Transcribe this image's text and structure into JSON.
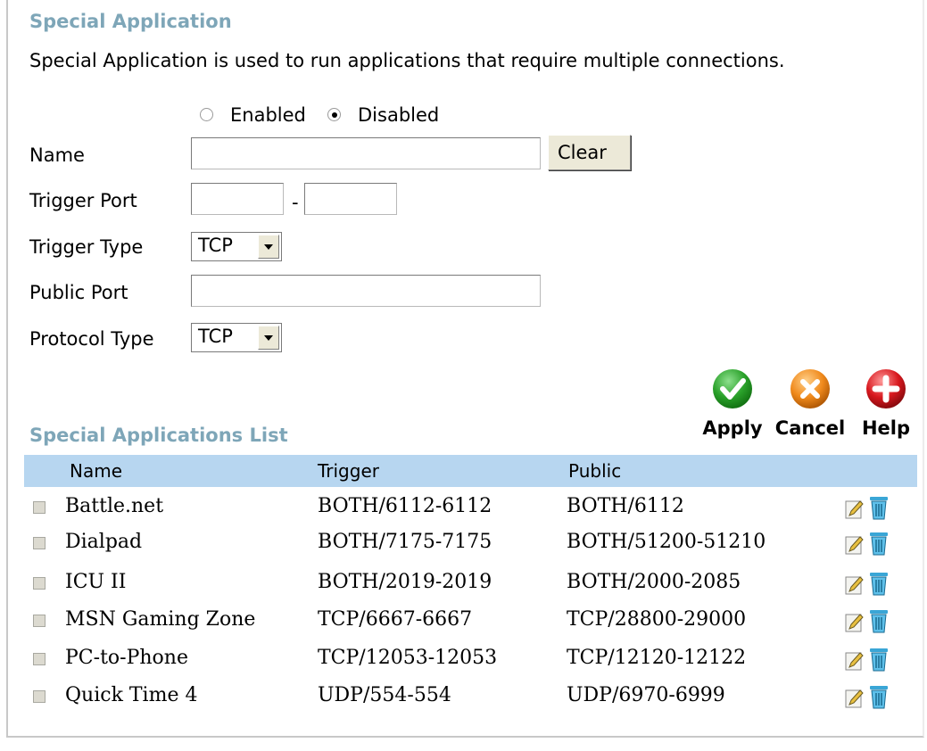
{
  "header": {
    "title": "Special Application",
    "description": "Special Application is used to run applications that require multiple connections."
  },
  "form": {
    "enabled_label": "Enabled",
    "disabled_label": "Disabled",
    "selected": "Disabled",
    "name_label": "Name",
    "name_value": "",
    "clear_label": "Clear",
    "trigger_port_label": "Trigger Port",
    "trigger_port_start": "",
    "trigger_port_sep": "-",
    "trigger_port_end": "",
    "trigger_type_label": "Trigger Type",
    "trigger_type_value": "TCP",
    "public_port_label": "Public Port",
    "public_port_value": "",
    "protocol_type_label": "Protocol Type",
    "protocol_type_value": "TCP"
  },
  "actions": {
    "apply_label": "Apply",
    "cancel_label": "Cancel",
    "help_label": "Help",
    "apply_color": "#2aa12a",
    "cancel_color": "#f08a1c",
    "help_color": "#d8181e"
  },
  "list": {
    "title": "Special Applications List",
    "columns": [
      "Name",
      "Trigger",
      "Public"
    ],
    "header_color": "#b7d6f0",
    "rows": [
      {
        "name": "Battle.net",
        "trigger": "BOTH/6112-6112",
        "public": "BOTH/6112"
      },
      {
        "name": "Dialpad",
        "trigger": "BOTH/7175-7175",
        "public": "BOTH/51200-51210"
      },
      {
        "name": "ICU II",
        "trigger": "BOTH/2019-2019",
        "public": "BOTH/2000-2085"
      },
      {
        "name": "MSN Gaming Zone",
        "trigger": "TCP/6667-6667",
        "public": "TCP/28800-29000"
      },
      {
        "name": "PC-to-Phone",
        "trigger": "TCP/12053-12053",
        "public": "TCP/12120-12122"
      },
      {
        "name": "Quick Time 4",
        "trigger": "UDP/554-554",
        "public": "UDP/6970-6999"
      }
    ]
  }
}
